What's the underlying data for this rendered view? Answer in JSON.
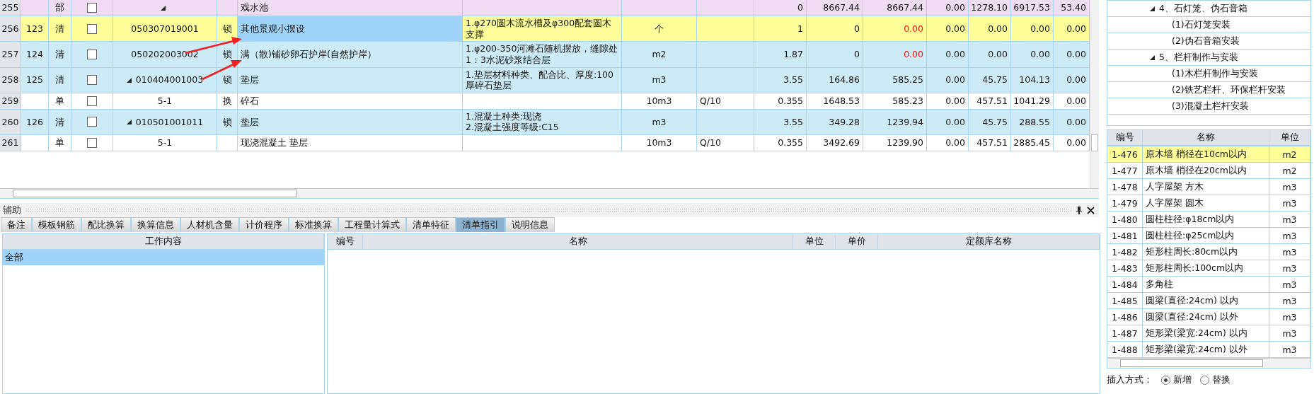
{
  "main_table": {
    "rows": [
      {
        "kind": "section",
        "selected": false,
        "checked": false,
        "expanded": true,
        "alert": false,
        "cells": [
          "255",
          "",
          "部",
          "",
          "",
          "戏水池",
          "",
          "",
          "",
          "0",
          "8667.44",
          "8667.44",
          "0.00",
          "1278.10",
          "6917.53",
          "53.40"
        ]
      },
      {
        "kind": "item",
        "selected": true,
        "checked": false,
        "expanded": false,
        "alert": true,
        "cells": [
          "256",
          "123",
          "清",
          "050307019001",
          "锁",
          "其他景观小摆设",
          "1.φ270圆木流水槽及φ300配套圆木支撑",
          "个",
          "",
          "1",
          "0",
          "0.00",
          "0.00",
          "0.00",
          "0.00",
          "0.00"
        ]
      },
      {
        "kind": "item",
        "selected": false,
        "checked": false,
        "expanded": false,
        "alert": true,
        "cells": [
          "257",
          "124",
          "清",
          "050202003002",
          "锁",
          "满（散)铺砂卵石护岸(自然护岸）",
          "1.φ200-350河滩石随机摆放，缝隙处1：3水泥砂浆结合层",
          "m2",
          "",
          "1.87",
          "0",
          "0.00",
          "0.00",
          "0.00",
          "0.00",
          "0.00"
        ]
      },
      {
        "kind": "item",
        "selected": false,
        "checked": false,
        "expanded": true,
        "alert": false,
        "cells": [
          "258",
          "125",
          "清",
          "010404001003",
          "锁",
          "垫层",
          "1.垫层材料种类、配合比、厚度:100厚碎石垫层",
          "m3",
          "",
          "3.55",
          "164.86",
          "585.25",
          "0.00",
          "45.75",
          "104.13",
          "0.00"
        ]
      },
      {
        "kind": "norm",
        "selected": false,
        "checked": false,
        "expanded": false,
        "alert": false,
        "cells": [
          "259",
          "",
          "单",
          "5-1",
          "换",
          "碎石",
          "",
          "10m3",
          "Q/10",
          "0.355",
          "1648.53",
          "585.23",
          "0.00",
          "457.51",
          "1041.29",
          "0.00"
        ]
      },
      {
        "kind": "item",
        "selected": false,
        "checked": false,
        "expanded": true,
        "alert": false,
        "cells": [
          "260",
          "126",
          "清",
          "010501001011",
          "锁",
          "垫层",
          "1.混凝土种类:现浇\n2.混凝土强度等级:C15",
          "m3",
          "",
          "3.55",
          "349.28",
          "1239.94",
          "0.00",
          "45.75",
          "288.55",
          "0.00"
        ]
      },
      {
        "kind": "norm",
        "selected": false,
        "checked": false,
        "expanded": false,
        "alert": false,
        "cells": [
          "261",
          "",
          "单",
          "5-1",
          "",
          "现浇混凝土 垫层",
          "",
          "10m3",
          "Q/10",
          "0.355",
          "3492.69",
          "1239.90",
          "0.00",
          "457.51",
          "2885.45",
          "0.00"
        ]
      }
    ]
  },
  "aux_panel": {
    "title": "辅助",
    "tabs": [
      {
        "label": "备注",
        "selected": false
      },
      {
        "label": "模板钢筋",
        "selected": false
      },
      {
        "label": "配比换算",
        "selected": false
      },
      {
        "label": "换算信息",
        "selected": false
      },
      {
        "label": "人材机含量",
        "selected": false
      },
      {
        "label": "计价程序",
        "selected": false
      },
      {
        "label": "标准换算",
        "selected": false
      },
      {
        "label": "工程量计算式",
        "selected": false
      },
      {
        "label": "清单特征",
        "selected": false
      },
      {
        "label": "清单指引",
        "selected": true
      },
      {
        "label": "说明信息",
        "selected": false
      }
    ],
    "work_table": {
      "column": "工作内容",
      "rows": [
        {
          "text": "全部",
          "selected": true
        }
      ]
    },
    "guide_table": {
      "columns": [
        "编号",
        "名称",
        "单位",
        "单价",
        "定额库名称"
      ]
    }
  },
  "tree": [
    {
      "label": "4、石灯笼、伪石音箱",
      "expanded": true,
      "children": [
        {
          "label": "(1)石灯笼安装"
        },
        {
          "label": "(2)伪石音箱安装"
        }
      ]
    },
    {
      "label": "5、栏杆制作与安装",
      "expanded": true,
      "children": [
        {
          "label": "(1)木栏杆制作与安装"
        },
        {
          "label": "(2)铁艺栏杆、环保栏杆安装"
        },
        {
          "label": "(3)混凝土栏杆安装"
        }
      ]
    }
  ],
  "norm_list": {
    "columns": [
      "编号",
      "名称",
      "单位"
    ],
    "rows": [
      {
        "code": "1-476",
        "name": "原木墙 梢径在10cm以内",
        "unit": "m2",
        "selected": true
      },
      {
        "code": "1-477",
        "name": "原木墙 梢径在20cm以内",
        "unit": "m2",
        "selected": false
      },
      {
        "code": "1-478",
        "name": "人字屋架 方木",
        "unit": "m3",
        "selected": false
      },
      {
        "code": "1-479",
        "name": "人字屋架 圆木",
        "unit": "m3",
        "selected": false
      },
      {
        "code": "1-480",
        "name": "圆柱柱径:φ18cm以内",
        "unit": "m3",
        "selected": false
      },
      {
        "code": "1-481",
        "name": "圆柱柱径:φ25cm以内",
        "unit": "m3",
        "selected": false
      },
      {
        "code": "1-482",
        "name": "矩形柱周长:80cm以内",
        "unit": "m3",
        "selected": false
      },
      {
        "code": "1-483",
        "name": "矩形柱周长:100cm以内",
        "unit": "m3",
        "selected": false
      },
      {
        "code": "1-484",
        "name": "多角柱",
        "unit": "m3",
        "selected": false
      },
      {
        "code": "1-485",
        "name": "圆梁(直径:24cm) 以内",
        "unit": "m3",
        "selected": false
      },
      {
        "code": "1-486",
        "name": "圆梁(直径:24cm) 以外",
        "unit": "m3",
        "selected": false
      },
      {
        "code": "1-487",
        "name": "矩形梁(梁宽:24cm) 以内",
        "unit": "m3",
        "selected": false
      },
      {
        "code": "1-488",
        "name": "矩形梁(梁宽:24cm) 以外",
        "unit": "m3",
        "selected": false
      }
    ]
  },
  "insert_mode": {
    "label": "插入方式：",
    "options": [
      {
        "label": "新增",
        "selected": true
      },
      {
        "label": "替换",
        "selected": false
      }
    ]
  }
}
